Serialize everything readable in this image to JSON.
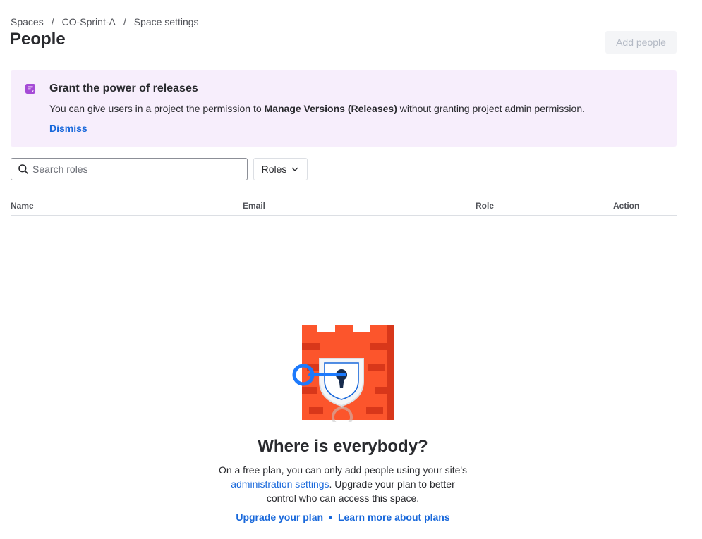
{
  "breadcrumbs": [
    "Spaces",
    "CO-Sprint-A",
    "Space settings"
  ],
  "breadcrumb_separator": "/",
  "page_title": "People",
  "add_people_label": "Add people",
  "banner": {
    "title": "Grant the power of releases",
    "body_before": "You can give users in a project the permission to ",
    "body_bold": "Manage Versions (Releases)",
    "body_after": " without granting project admin permission.",
    "dismiss_label": "Dismiss",
    "icon": "release-note-icon",
    "accent_color": "#a54ad6"
  },
  "search": {
    "placeholder": "Search roles",
    "value": ""
  },
  "roles_filter_label": "Roles",
  "table": {
    "columns": [
      "Name",
      "Email",
      "Role",
      "Action"
    ]
  },
  "empty_state": {
    "illustration": "locked-castle-illustration",
    "title": "Where is everybody?",
    "desc_before": "On a free plan, you can only add people using your site's ",
    "desc_link": "administration settings",
    "desc_after": ". Upgrade your plan to better control who can access this space.",
    "link_upgrade": "Upgrade your plan",
    "link_learn": "Learn more about plans",
    "link_separator": "•"
  },
  "colors": {
    "link": "#1868db",
    "banner_bg": "#f7eefc",
    "castle": "#fc552c"
  }
}
